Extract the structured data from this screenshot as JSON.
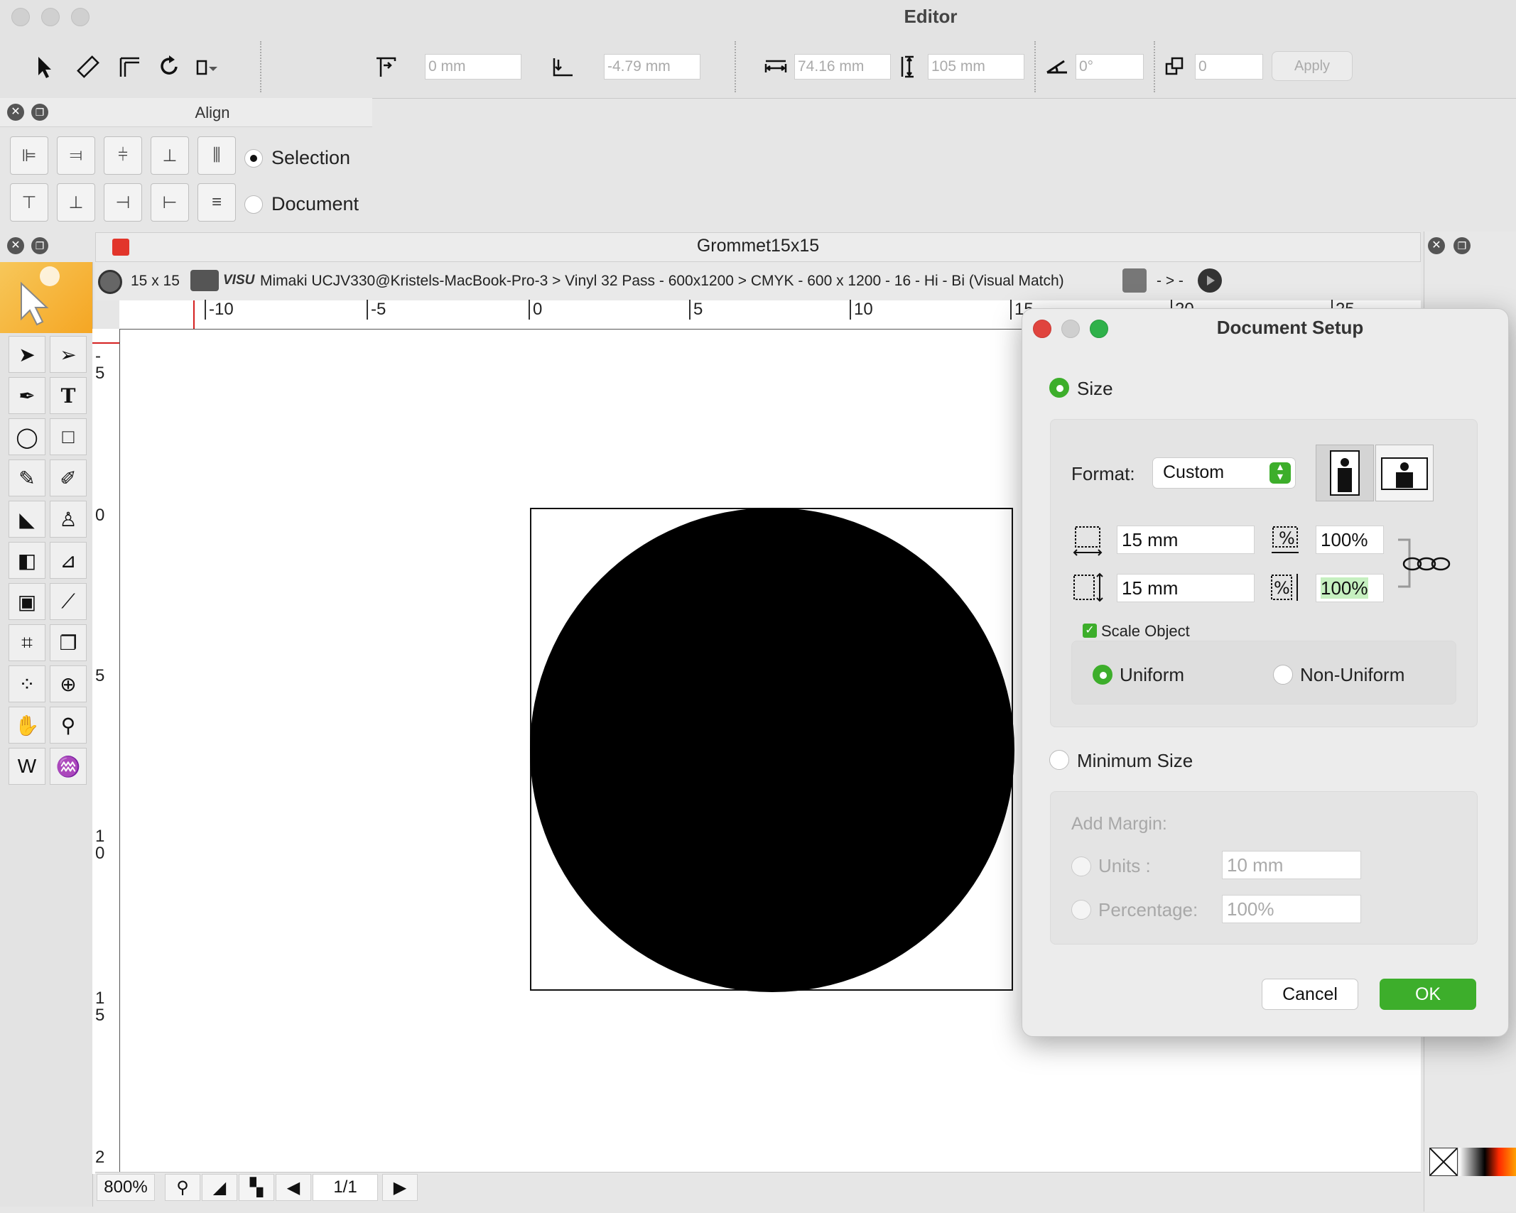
{
  "window": {
    "title": "Editor"
  },
  "toolbar": {
    "x_field": "0 mm",
    "y_field": "-4.79 mm",
    "width_field": "74.16 mm",
    "height_field": "105 mm",
    "angle_field": "0°",
    "copies_field": "0",
    "apply_label": "Apply"
  },
  "align": {
    "title": "Align",
    "selection_label": "Selection",
    "document_label": "Document"
  },
  "document": {
    "title": "Grommet15x15",
    "size_label": "15 x 15",
    "visu_label": "VISU",
    "printer_path": "Mimaki UCJV330@Kristels-MacBook-Pro-3 > Vinyl 32 Pass - 600x1200 > CMYK - 600 x 1200 - 16 - Hi - Bi (Visual Match)",
    "arrows": "- > -"
  },
  "ruler": {
    "h_labels": [
      "-10",
      "-5",
      "0",
      "5",
      "10",
      "15",
      "20",
      "25"
    ],
    "v_labels": [
      "-\n5",
      "0",
      "5",
      "1\n0",
      "1\n5",
      "2"
    ]
  },
  "bottom": {
    "zoom": "800%",
    "page": "1/1"
  },
  "dialog": {
    "title": "Document Setup",
    "size_label": "Size",
    "format_label": "Format:",
    "format_value": "Custom",
    "width_value": "15 mm",
    "height_value": "15 mm",
    "width_pct": "100%",
    "height_pct": "100%",
    "scale_object_label": "Scale Object",
    "uniform_label": "Uniform",
    "non_uniform_label": "Non-Uniform",
    "min_size_label": "Minimum Size",
    "add_margin_label": "Add Margin:",
    "units_label": "Units :",
    "units_value": "10 mm",
    "percentage_label": "Percentage:",
    "percentage_value": "100%",
    "cancel_label": "Cancel",
    "ok_label": "OK"
  },
  "colors": {
    "accent_green": "#3dae2b",
    "close_red": "#e0443e",
    "min_gray": "#cfcfcf",
    "zoom_green": "#2fb14a"
  }
}
